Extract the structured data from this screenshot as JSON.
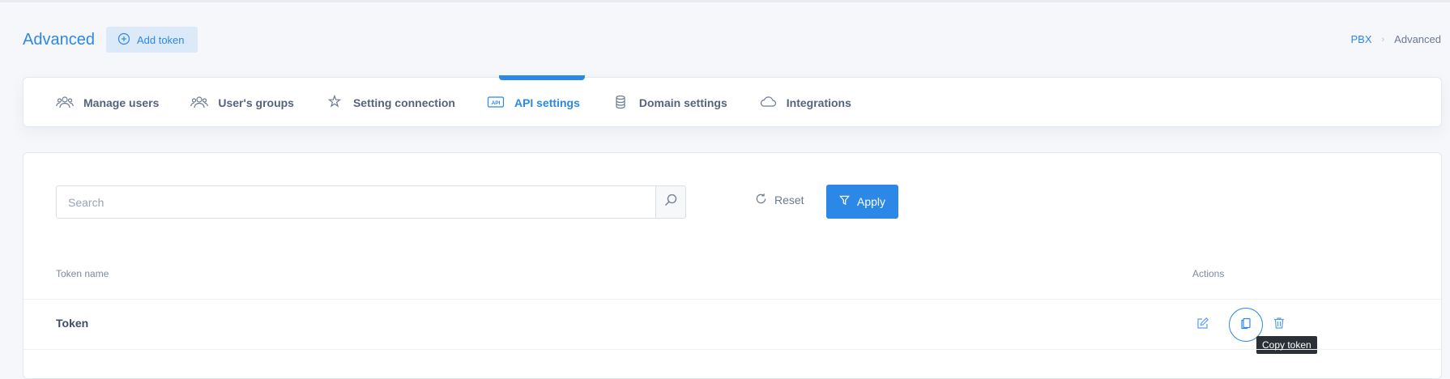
{
  "header": {
    "title": "Advanced",
    "add_token_label": "Add token"
  },
  "breadcrumb": {
    "items": [
      "PBX",
      "Advanced"
    ],
    "separator": "›"
  },
  "tabs": [
    {
      "label": "Manage users",
      "icon": "users-icon",
      "active": false
    },
    {
      "label": "User's groups",
      "icon": "groups-icon",
      "active": false
    },
    {
      "label": "Setting connection",
      "icon": "sparkle-icon",
      "active": false
    },
    {
      "label": "API settings",
      "icon": "api-icon",
      "active": true
    },
    {
      "label": "Domain settings",
      "icon": "database-icon",
      "active": false
    },
    {
      "label": "Integrations",
      "icon": "cloud-icon",
      "active": false
    }
  ],
  "filters": {
    "search_placeholder": "Search",
    "search_value": "",
    "reset_label": "Reset",
    "apply_label": "Apply"
  },
  "table": {
    "columns": [
      "Token name",
      "Actions"
    ],
    "rows": [
      {
        "name": "Token"
      }
    ]
  },
  "tooltip": {
    "text": "Copy token"
  },
  "colors": {
    "accent": "#2c88e6",
    "background": "#f5f7fa",
    "card": "#ffffff",
    "text": "#3f4d67"
  }
}
